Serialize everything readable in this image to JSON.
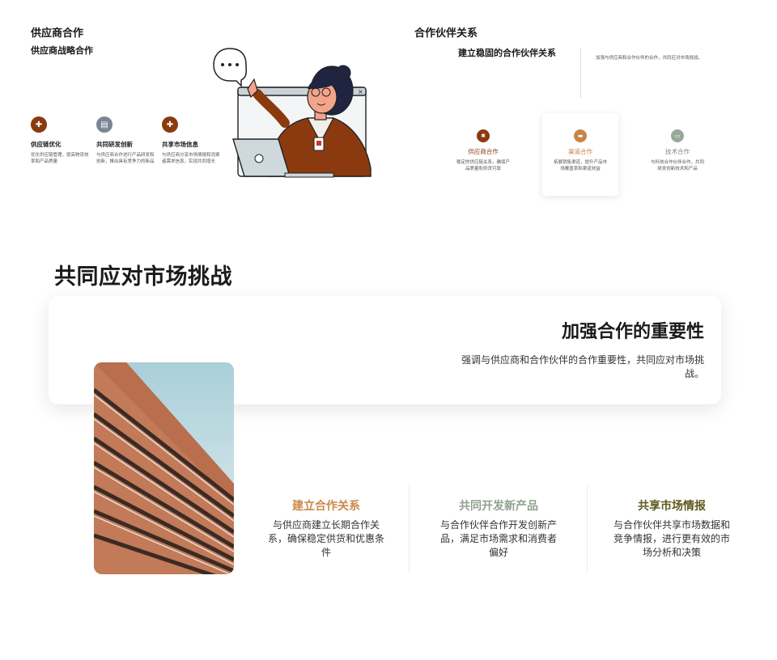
{
  "slide_supplier": {
    "title": "供应商合作",
    "subtitle": "供应商战略合作",
    "features": [
      {
        "icon": "puzzle-icon",
        "color": "#8b3a0f",
        "title": "供应链优化",
        "desc": "优化供应链管理，提高物流效率和产品质量"
      },
      {
        "icon": "clipboard-icon",
        "color": "#7a8594",
        "title": "共同研发创新",
        "desc": "与供应商合作进行产品研发和创新，推出具有竞争力的新品"
      },
      {
        "icon": "puzzle-icon",
        "color": "#8b3a0f",
        "title": "共享市场信息",
        "desc": "与供应商分享市场情报和消费者需求信息，实现共同增长"
      }
    ]
  },
  "slide_partner": {
    "title": "合作伙伴关系",
    "subtitle": "建立稳固的合作伙伴关系",
    "desc": "加强与供应商和合作伙伴的合作，共同应对市场挑战。",
    "cards": [
      {
        "icon": "gear-icon",
        "color": "#8b3a0f",
        "title": "供应商合作",
        "title_color": "#8b3a0f",
        "desc": "稳定的供应链关系，确保产品质量和供货可靠"
      },
      {
        "icon": "briefcase-icon",
        "color": "#c9844a",
        "title": "渠道合作",
        "title_color": "#c9844a",
        "desc": "拓展销售渠道，提升产品市场覆盖率和渠道效益"
      },
      {
        "icon": "monitor-icon",
        "color": "#9aa89a",
        "title": "技术合作",
        "title_color": "#7d8b7d",
        "desc": "与科技合作伙伴合作，共同研发创新技术和产品"
      }
    ]
  },
  "slide_challenge": {
    "title": "共同应对市场挑战",
    "heading": "加强合作的重要性",
    "desc": "强调与供应商和合作伙伴的合作重要性，共同应对市场挑战。",
    "columns": [
      {
        "title": "建立合作关系",
        "color": "#c98a4b",
        "desc": "与供应商建立长期合作关系，确保稳定供货和优惠条件"
      },
      {
        "title": "共同开发新产品",
        "color": "#8fa08f",
        "desc": "与合作伙伴合作开发创新产品，满足市场需求和消费者偏好"
      },
      {
        "title": "共享市场情报",
        "color": "#5e5a1e",
        "desc": "与合作伙伴共享市场数据和竞争情报，进行更有效的市场分析和决策"
      }
    ]
  }
}
